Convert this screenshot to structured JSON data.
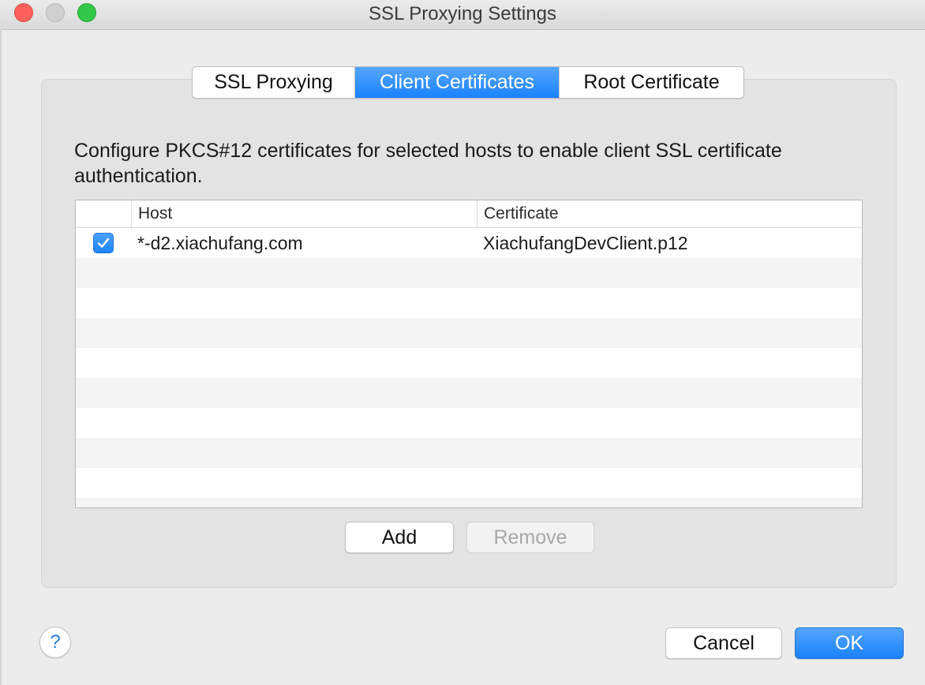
{
  "window": {
    "title": "SSL Proxying Settings"
  },
  "tabs": [
    {
      "label": "SSL Proxying",
      "active": false
    },
    {
      "label": "Client Certificates",
      "active": true
    },
    {
      "label": "Root Certificate",
      "active": false
    }
  ],
  "description": "Configure PKCS#12 certificates for selected hosts to enable client SSL certificate authentication.",
  "table": {
    "columns": [
      "",
      "Host",
      "Certificate"
    ],
    "rows": [
      {
        "enabled": true,
        "host": "*-d2.xiachufang.com",
        "certificate": "XiachufangDevClient.p12"
      }
    ]
  },
  "buttons": {
    "add": "Add",
    "remove": "Remove",
    "cancel": "Cancel",
    "ok": "OK",
    "help": "?"
  },
  "colors": {
    "accent": "#1a82fb",
    "close": "#fc605c",
    "zoom": "#34c84a",
    "disabled_text": "#a8a8a8"
  },
  "icons": {
    "close": "close-button-icon",
    "minimize": "minimize-button-icon",
    "zoom": "zoom-button-icon",
    "checkbox": "checkmark-icon",
    "help": "question-mark-icon"
  }
}
